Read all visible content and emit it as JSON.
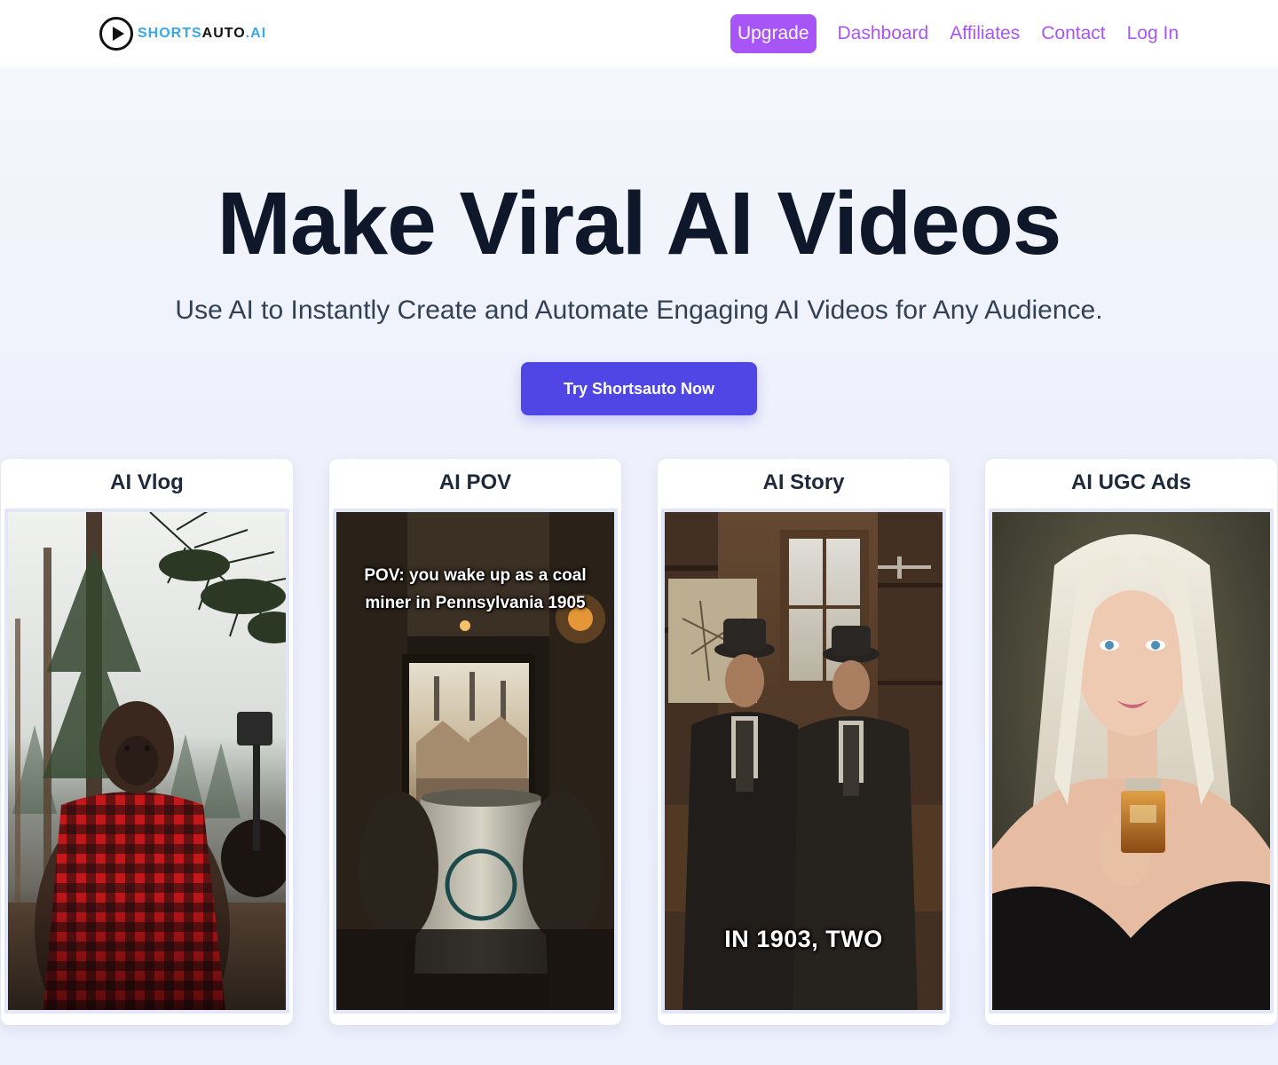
{
  "header": {
    "logo": {
      "part1": "SHORTS",
      "part2": "AUTO",
      "part3": ".AI"
    },
    "nav": [
      {
        "label": "Upgrade",
        "style": "primary"
      },
      {
        "label": "Dashboard"
      },
      {
        "label": "Affiliates"
      },
      {
        "label": "Contact"
      },
      {
        "label": "Log In"
      }
    ]
  },
  "hero": {
    "title": "Make Viral AI Videos",
    "subtitle": "Use AI to Instantly Create and Automate Engaging AI Videos for Any Audience.",
    "cta": "Try Shortsauto Now"
  },
  "cards": [
    {
      "title": "AI Vlog",
      "caption_top": "",
      "caption_bottom": ""
    },
    {
      "title": "AI POV",
      "caption_top": "POV: you wake up as a coal miner in Pennsylvania 1905",
      "caption_bottom": ""
    },
    {
      "title": "AI Story",
      "caption_top": "",
      "caption_bottom": "IN 1903, TWO"
    },
    {
      "title": "AI UGC Ads",
      "caption_top": "",
      "caption_bottom": ""
    }
  ],
  "colors": {
    "accent_purple": "#a855f7",
    "cta_indigo": "#4f46e5",
    "logo_blue": "#3aa8e6",
    "title_dark": "#0f172a"
  },
  "icons": {
    "logo": "play-circle-icon"
  }
}
